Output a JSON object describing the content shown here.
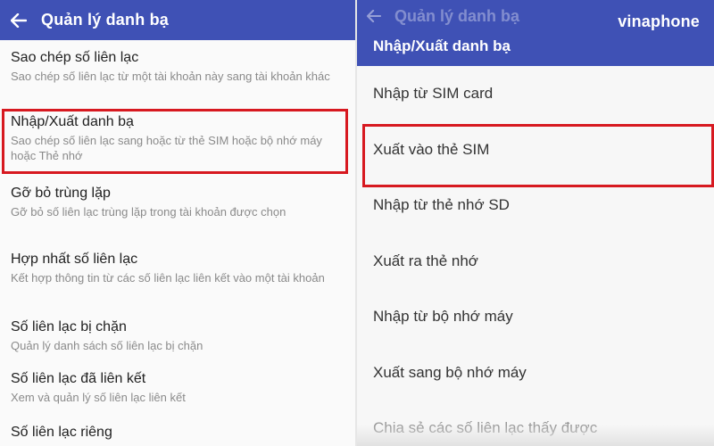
{
  "left": {
    "appbar": {
      "title": "Quản lý danh bạ",
      "back_icon": "arrow-left-icon"
    },
    "items": [
      {
        "title": "Sao chép số liên lạc",
        "subtitle": "Sao chép số liên lạc từ một tài khoản này sang tài khoản khác"
      },
      {
        "title": "Nhập/Xuất danh bạ",
        "subtitle": "Sao chép số liên lạc sang hoặc từ thẻ SIM hoặc bộ nhớ máy hoặc Thẻ nhớ"
      },
      {
        "title": "Gỡ bỏ trùng lặp",
        "subtitle": "Gỡ bỏ số liên lạc trùng lặp trong tài khoản được chọn"
      },
      {
        "title": "Hợp nhất số liên lạc",
        "subtitle": "Kết hợp thông tin từ các số liên lạc liên kết vào một tài khoản"
      },
      {
        "title": "Số liên lạc bị chặn",
        "subtitle": "Quản lý danh sách số liên lạc bị chặn"
      },
      {
        "title": "Số liên lạc đã liên kết",
        "subtitle": "Xem và quản lý số liên lạc liên kết"
      },
      {
        "title": "Số liên lạc riêng",
        "subtitle": ""
      }
    ]
  },
  "right": {
    "faded_title": "Quản lý danh bạ",
    "brand": "vinaphone",
    "dialog_title": "Nhập/Xuất danh bạ",
    "options": [
      "Nhập từ SIM card",
      "Xuất vào thẻ SIM",
      "Nhập từ thẻ nhớ SD",
      "Xuất ra thẻ nhớ",
      "Nhập từ bộ nhớ máy",
      "Xuất sang bộ nhớ máy",
      "Chia sẻ các số liên lạc thấy được"
    ]
  },
  "colors": {
    "appbar": "#3f51b5",
    "highlight": "#d71920"
  }
}
